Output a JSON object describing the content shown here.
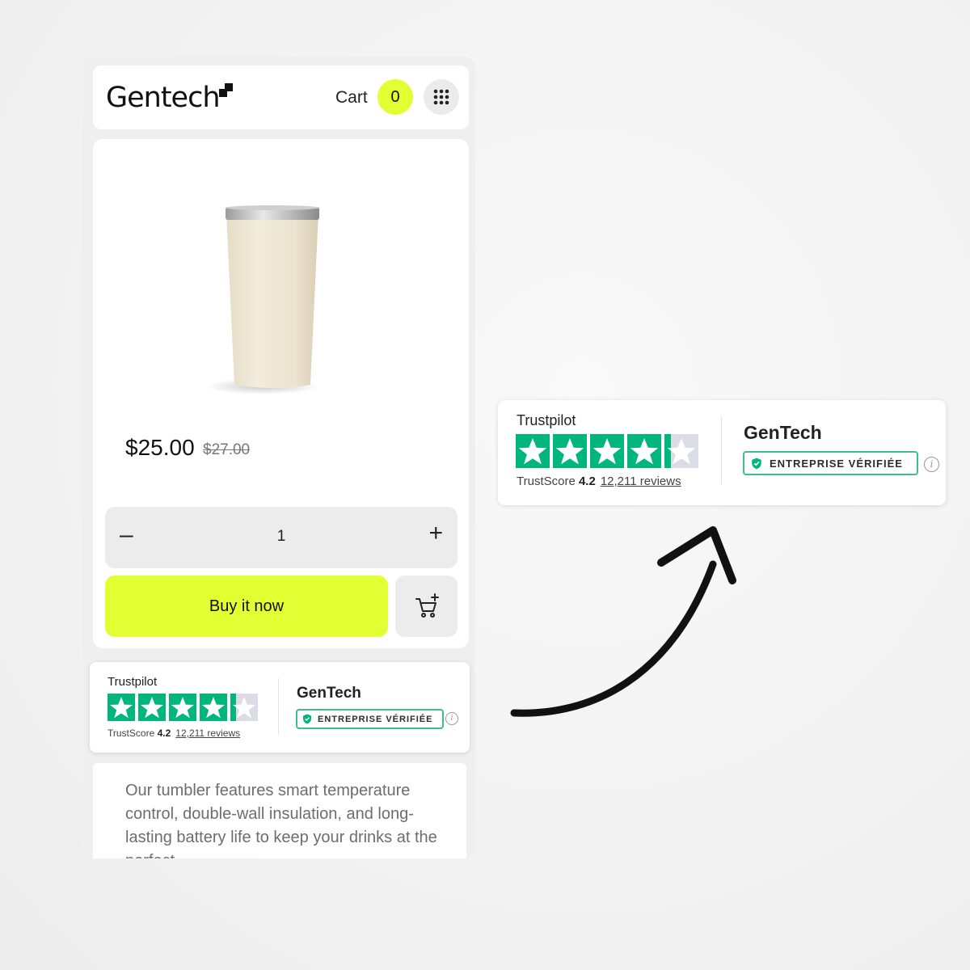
{
  "header": {
    "logo_text": "Gentech",
    "cart_label": "Cart",
    "cart_count": "0"
  },
  "product": {
    "price": "$25.00",
    "old_price": "$27.00",
    "quantity": "1",
    "minus_label": "–",
    "plus_label": "+",
    "buy_label": "Buy it now"
  },
  "trustpilot": {
    "brand": "Trustpilot",
    "score_label": "TrustScore",
    "score": "4.2",
    "rating": 4.2,
    "reviews": "12,211 reviews",
    "company": "GenTech",
    "verified_label": "ENTREPRISE VÉRIFIÉE",
    "info_label": "i"
  },
  "description": {
    "text": "Our tumbler features smart temperature control, double-wall insulation, and long-lasting battery life to keep your drinks at the perfect"
  },
  "colors": {
    "accent": "#e2ff33",
    "trustpilot_green": "#00b67a",
    "star_empty": "#dcdce6"
  },
  "icons": {
    "menu": "grid-dots-icon",
    "add_to_cart": "cart-plus-icon",
    "verified": "shield-check-icon",
    "info": "info-icon",
    "arrow": "curved-arrow-icon"
  }
}
